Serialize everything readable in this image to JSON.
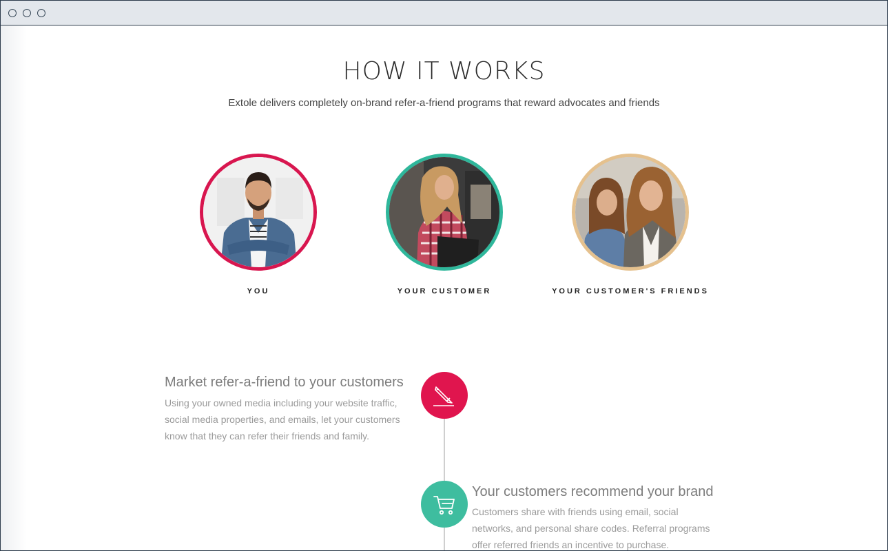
{
  "page": {
    "title": "HOW IT WORKS",
    "subtitle": "Extole delivers completely on-brand refer-a-friend programs that reward advocates and friends"
  },
  "personas": [
    {
      "label": "YOU",
      "ring_color": "#d8164f"
    },
    {
      "label": "YOUR CUSTOMER",
      "ring_color": "#2fb79b"
    },
    {
      "label": "YOUR CUSTOMER'S FRIENDS",
      "ring_color": "#e5c18e"
    }
  ],
  "steps": [
    {
      "title": "Market refer-a-friend to your customers",
      "lines": [
        "Using your owned media including your website traffic,",
        "social media properties, and emails, let your customers",
        "know that they can refer their friends and family."
      ],
      "icon": "pencil-icon",
      "color": "#e0154e"
    },
    {
      "title": "Your customers recommend your brand",
      "lines": [
        "Customers share with friends using email, social",
        "networks, and personal share codes. Referral programs",
        "offer referred friends an incentive to purchase."
      ],
      "icon": "cart-icon",
      "color": "#3ebd9f"
    }
  ]
}
